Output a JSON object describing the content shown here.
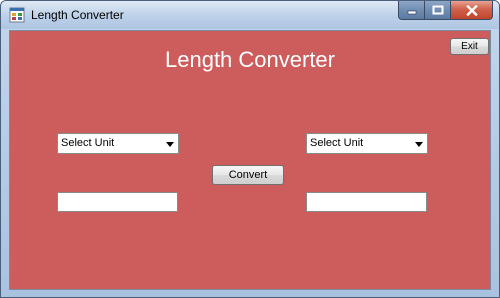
{
  "window": {
    "title": "Length Converter",
    "icon": "app-icon",
    "controls": {
      "minimize_icon": "minimize-icon",
      "maximize_icon": "maximize-icon",
      "close_icon": "close-icon"
    }
  },
  "form": {
    "background_color": "#cd5c5c",
    "heading": "Length Converter",
    "exit_label": "Exit",
    "from_unit": {
      "selected": "Select Unit"
    },
    "to_unit": {
      "selected": "Select Unit"
    },
    "convert_label": "Convert",
    "input_value": "",
    "output_value": ""
  }
}
